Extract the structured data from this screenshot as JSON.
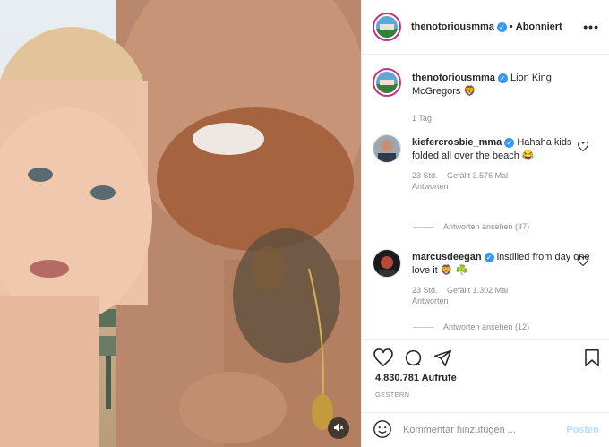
{
  "header": {
    "username": "thenotoriousmma",
    "separator": "•",
    "follow_label": "Abonniert",
    "more_label": "•••"
  },
  "caption": {
    "username": "thenotoriousmma",
    "text": "Lion King McGregors 🦁",
    "time": "1 Tag"
  },
  "comments": [
    {
      "username": "kiefercrosbie_mma",
      "text": "Hahaha kids folded all over the beach 😂",
      "time": "23 Std.",
      "likes": "Gefällt 3.576 Mal",
      "reply_label": "Antworten",
      "view_replies": "Antworten ansehen (37)"
    },
    {
      "username": "marcusdeegan",
      "text": "instilled from day one love it 🦁 ☘️",
      "time": "23 Std.",
      "likes": "Gefällt 1.302 Mal",
      "reply_label": "Antworten",
      "view_replies": "Antworten ansehen (12)"
    }
  ],
  "stats": {
    "views": "4.830.781 Aufrufe",
    "date": "GESTERN"
  },
  "comment_box": {
    "placeholder": "Kommentar hinzufügen ...",
    "post_label": "Posten"
  },
  "icons": {
    "verified": "verified-badge-icon",
    "like": "heart-icon",
    "comment": "comment-bubble-icon",
    "share": "paper-plane-icon",
    "save": "bookmark-icon",
    "emoji": "smiley-icon",
    "mute": "speaker-muted-icon"
  },
  "colors": {
    "verified_blue": "#3897f0",
    "post_button": "#b2dffc",
    "meta_gray": "#8e8e8e"
  }
}
